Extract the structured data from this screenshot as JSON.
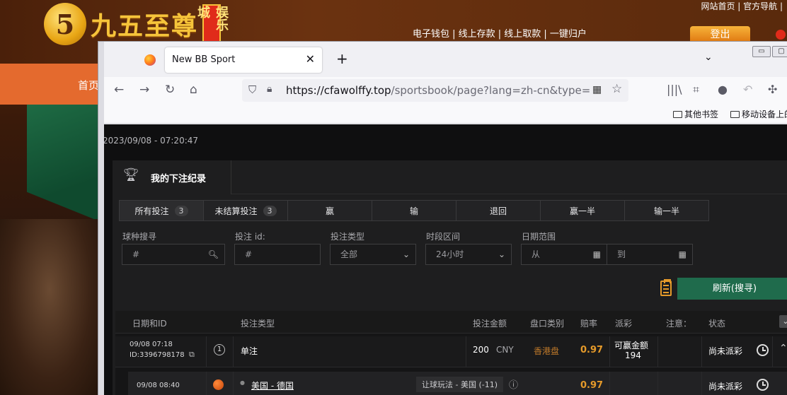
{
  "background_site": {
    "logo_text": "九五至尊",
    "logo_badge": "5",
    "logo_sub": "娱乐城",
    "top_links": "网站首页 | 官方导航 |",
    "nav_links": "电子钱包 | 线上存款 | 线上取款 | 一键归户",
    "login_button": "登出",
    "home_link": "首页"
  },
  "browser": {
    "tab_title": "New BB Sport",
    "new_tab": "+",
    "url_host": "https://cfawolffy.top",
    "url_path": "/sportsbook/page?lang=zh-cn&type=&pag",
    "bookmarks": [
      "其他书签",
      "移动设备上的"
    ]
  },
  "page": {
    "timestamp": "2023/09/08 - 07:20:47",
    "panel_title": "我的下注纪录",
    "tabs": [
      {
        "label": "所有投注",
        "count": "3"
      },
      {
        "label": "未结算投注",
        "count": "3"
      },
      {
        "label": "赢",
        "count": ""
      },
      {
        "label": "输",
        "count": ""
      },
      {
        "label": "退回",
        "count": ""
      },
      {
        "label": "赢一半",
        "count": ""
      },
      {
        "label": "输一半",
        "count": ""
      }
    ],
    "filters": {
      "sport_label": "球种搜寻",
      "sport_placeholder": "#",
      "bet_id_label": "投注 id:",
      "bet_id_placeholder": "#",
      "bet_type_label": "投注类型",
      "bet_type_value": "全部",
      "period_label": "时段区间",
      "period_value": "24小时",
      "date_label": "日期范围",
      "date_from": "从",
      "date_to": "到"
    },
    "refresh_button": "刷新(搜寻)",
    "table": {
      "headers": [
        "日期和ID",
        "投注类型",
        "投注金额",
        "盘口类别",
        "赔率",
        "派彩",
        "注意：",
        "状态"
      ],
      "rows": [
        {
          "date": "09/08 07:18",
          "id": "ID:3396798178",
          "num": "1",
          "bet_type": "单注",
          "amount": "200",
          "currency": "CNY",
          "market": "香港盘",
          "odds": "0.97",
          "payout_label": "可赢金额",
          "payout_value": "194",
          "status": "尚未派彩"
        }
      ],
      "sub_rows": [
        {
          "date": "09/08 08:40",
          "match": "美国 - 德国",
          "handicap": "让球玩法 - 美国 (-11)",
          "odds": "0.97",
          "status": "尚未派彩"
        }
      ]
    }
  },
  "colors": {
    "accent_green": "#1f6b4c",
    "odds_orange": "#e59a2a",
    "page_bg": "#0f0f10"
  }
}
